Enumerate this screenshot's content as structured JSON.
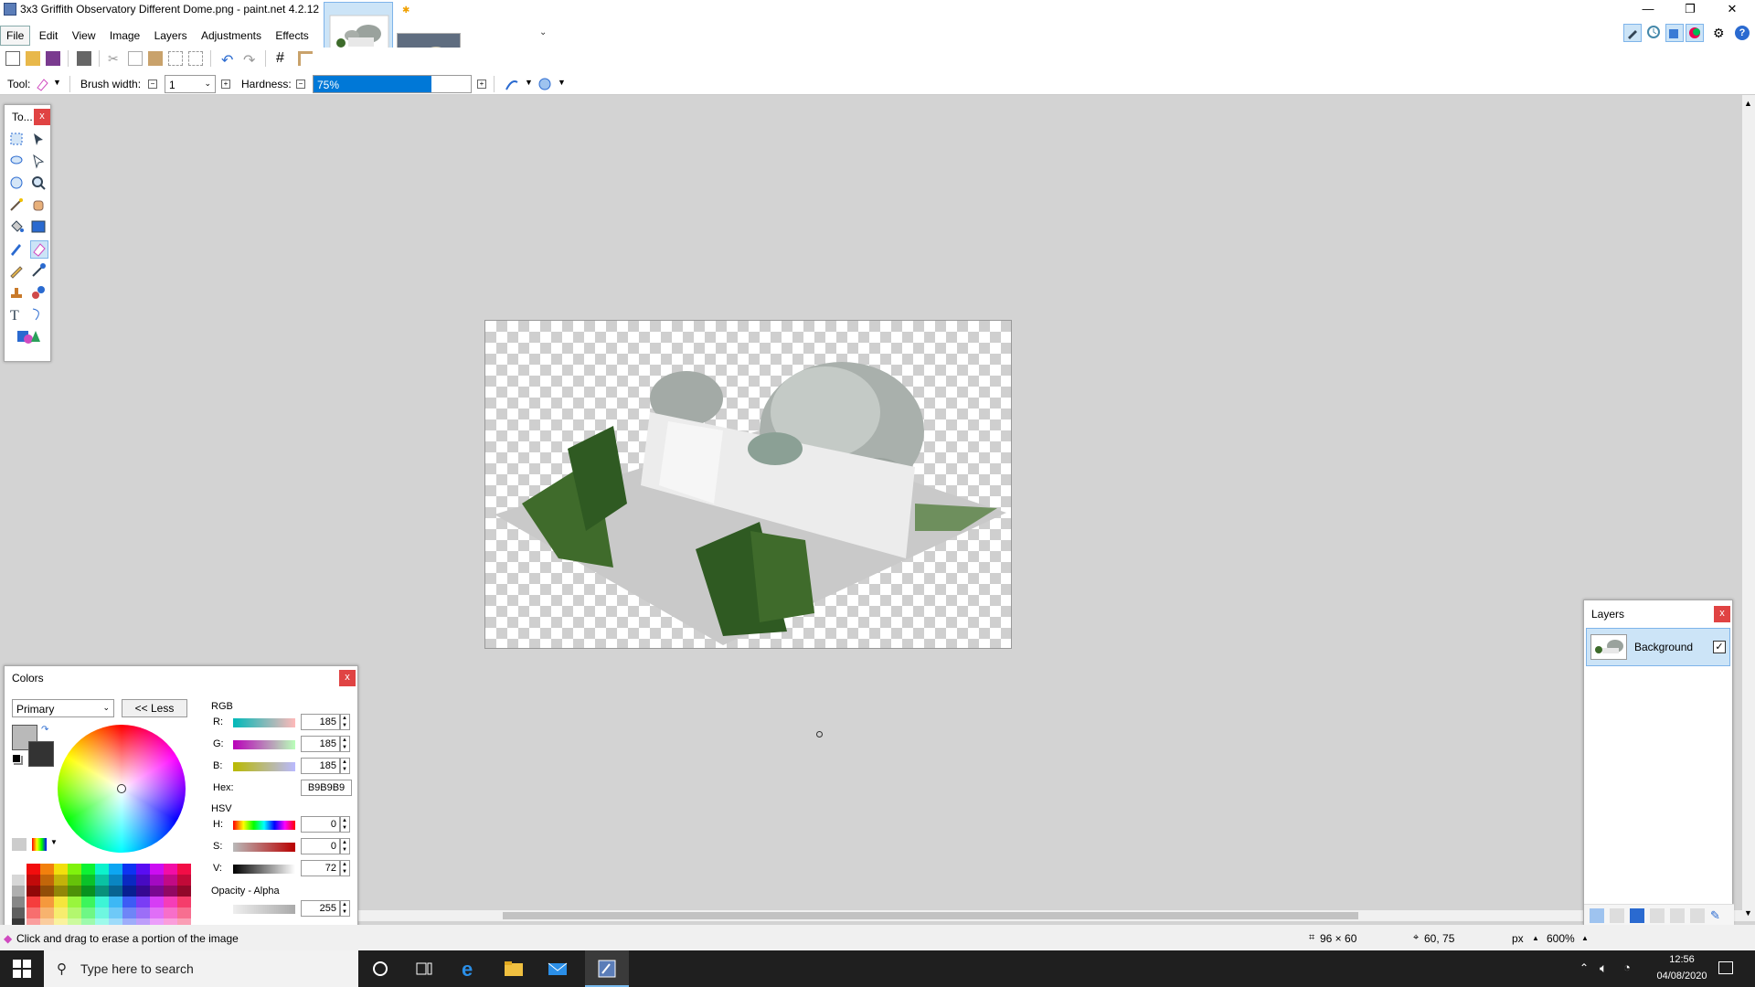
{
  "window": {
    "title": "3x3 Griffith Observatory Different Dome.png - paint.net 4.2.12",
    "controls": {
      "minimize": "—",
      "restore": "❐",
      "close": "✕"
    }
  },
  "menu": [
    "File",
    "Edit",
    "View",
    "Image",
    "Layers",
    "Adjustments",
    "Effects"
  ],
  "toolbar2": {
    "tool_label": "Tool:",
    "brush_width_label": "Brush width:",
    "brush_width_value": "1",
    "hardness_label": "Hardness:",
    "hardness_value": "75%",
    "hardness_fraction": 0.75
  },
  "tools_panel": {
    "title": "To...",
    "close": "x"
  },
  "colors_panel": {
    "title": "Colors",
    "close": "x",
    "mode_select": "Primary",
    "less_button": "<< Less",
    "rgb_header": "RGB",
    "r_label": "R:",
    "r_value": "185",
    "g_label": "G:",
    "g_value": "185",
    "b_label": "B:",
    "b_value": "185",
    "hex_label": "Hex:",
    "hex_value": "B9B9B9",
    "hsv_header": "HSV",
    "h_label": "H:",
    "h_value": "0",
    "s_label": "S:",
    "s_value": "0",
    "v_label": "V:",
    "v_value": "72",
    "opacity_header": "Opacity - Alpha",
    "alpha_value": "255",
    "primary_color": "#b9b9b9",
    "secondary_color": "#333333"
  },
  "layers_panel": {
    "title": "Layers",
    "close": "x",
    "layers": [
      {
        "name": "Background",
        "visible": true
      }
    ]
  },
  "status": {
    "hint": "Click and drag to erase a portion of the image",
    "image_size": "96 × 60",
    "cursor_pos": "60, 75",
    "units": "px",
    "zoom": "600%"
  },
  "taskbar": {
    "search_placeholder": "Type here to search",
    "time": "12:56",
    "date": "04/08/2020"
  },
  "colors": {
    "accent": "#0078d7",
    "close_red": "#e04343",
    "selection_blue": "#cce4f7"
  }
}
